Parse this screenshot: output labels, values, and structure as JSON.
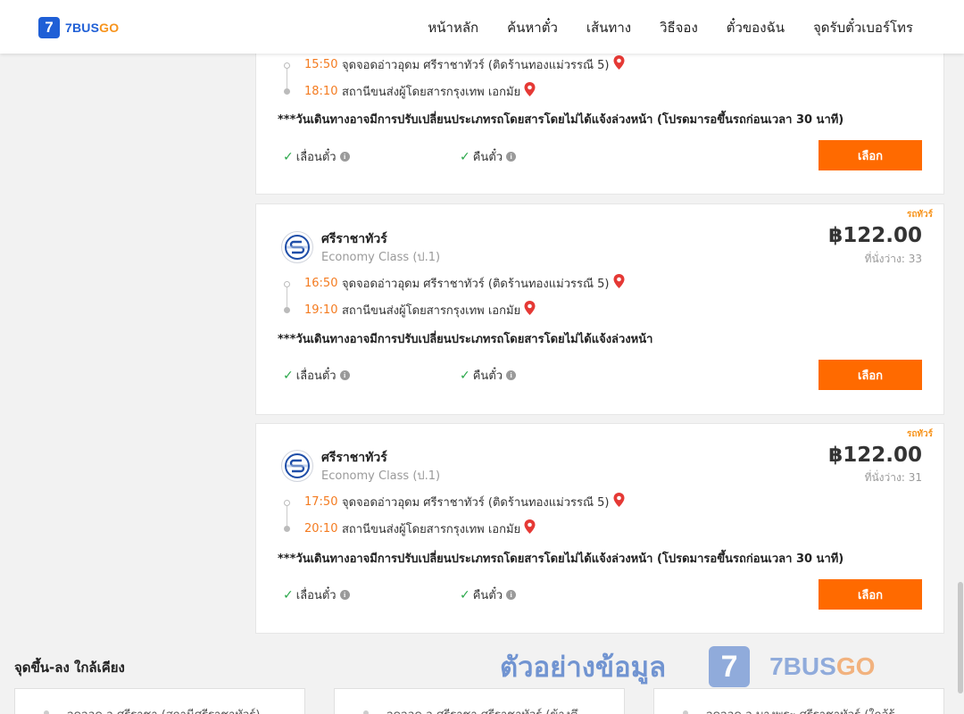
{
  "header": {
    "logo_mark": "7",
    "logo_text_a": "7BUS",
    "logo_text_b": "GO",
    "nav": [
      "หน้าหลัก",
      "ค้นหาตั๋ว",
      "เส้นทาง",
      "วิธีจอง",
      "ตั๋วของฉัน",
      "จุดรับตั๋วเบอร์โทร"
    ]
  },
  "trips": [
    {
      "depart_time": "15:50",
      "depart_place": "จุดจอดอ่าวอุดม ศรีราชาทัวร์ (ติดร้านทองแม่วรรณี 5)",
      "arrive_time": "18:10",
      "arrive_place": "สถานีขนส่งผู้โดยสารกรุงเทพ เอกมัย",
      "note": "***วันเดินทางอาจมีการปรับเปลี่ยนประเภทรถโดยสารโดยไม่ได้แจ้งล่วงหน้า (โปรดมารอขึ้นรถก่อนเวลา 30 นาที)",
      "opt_change": "เลื่อนตั๋ว",
      "opt_refund": "คืนตั๋ว",
      "select_label": "เลือก"
    },
    {
      "badge": "รถทัวร์",
      "operator": "ศรีราชาทัวร์",
      "class": "Economy Class (ป.1)",
      "price": "฿122.00",
      "seats": "ที่นั่งว่าง: 33",
      "depart_time": "16:50",
      "depart_place": "จุดจอดอ่าวอุดม ศรีราชาทัวร์ (ติดร้านทองแม่วรรณี 5)",
      "arrive_time": "19:10",
      "arrive_place": "สถานีขนส่งผู้โดยสารกรุงเทพ เอกมัย",
      "note": "***วันเดินทางอาจมีการปรับเปลี่ยนประเภทรถโดยสารโดยไม่ได้แจ้งล่วงหน้า",
      "opt_change": "เลื่อนตั๋ว",
      "opt_refund": "คืนตั๋ว",
      "select_label": "เลือก"
    },
    {
      "badge": "รถทัวร์",
      "operator": "ศรีราชาทัวร์",
      "class": "Economy Class (ป.1)",
      "price": "฿122.00",
      "seats": "ที่นั่งว่าง: 31",
      "depart_time": "17:50",
      "depart_place": "จุดจอดอ่าวอุดม ศรีราชาทัวร์ (ติดร้านทองแม่วรรณี 5)",
      "arrive_time": "20:10",
      "arrive_place": "สถานีขนส่งผู้โดยสารกรุงเทพ เอกมัย",
      "note": "***วันเดินทางอาจมีการปรับเปลี่ยนประเภทรถโดยสารโดยไม่ได้แจ้งล่วงหน้า (โปรดมารอขึ้นรถก่อนเวลา 30 นาที)",
      "opt_change": "เลื่อนตั๋ว",
      "opt_refund": "คืนตั๋ว",
      "select_label": "เลือก"
    }
  ],
  "nearby": {
    "title": "จุดขึ้น-ลง ใกล้เคียง",
    "items": [
      "จุดจอด อ.ศรีราชา (สถานีศรีราชาทัวร์)",
      "จุดจอด อ.ศรีราชา ศรีราชาทัวร์ (ข้างตึ",
      "จุดจอด อ.บางพระ ศรีราชาทัวร์ (ใกล้ร้"
    ]
  },
  "watermark": {
    "text": "ตัวอย่างข้อมูล",
    "mark": "7",
    "brand_a": "7BUS",
    "brand_b": "GO"
  },
  "colors": {
    "accent": "#ff6a00",
    "time": "#f47b20",
    "brand_blue": "#1f5fd6",
    "check": "#2aa84a"
  }
}
